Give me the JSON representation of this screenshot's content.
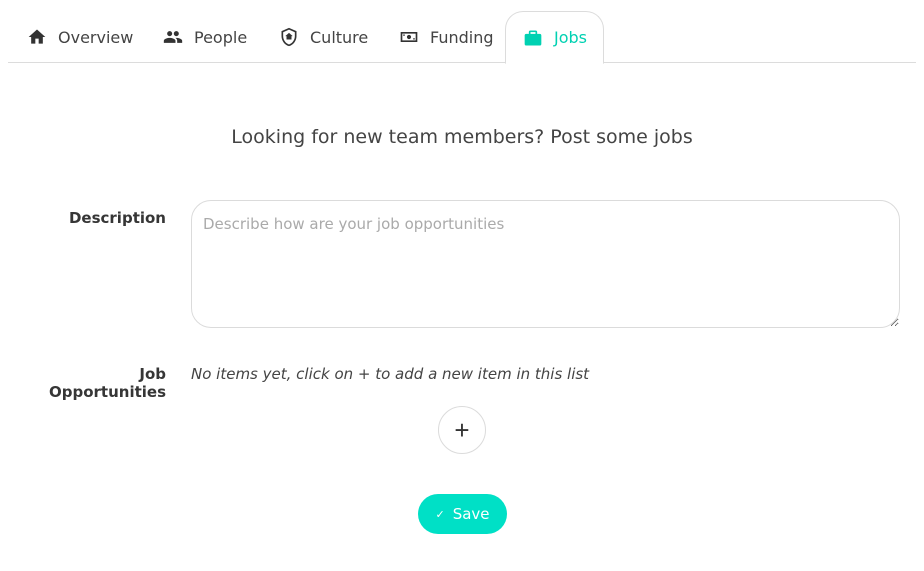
{
  "tabs": [
    {
      "label": "Overview",
      "icon": "home-icon",
      "active": false
    },
    {
      "label": "People",
      "icon": "people-icon",
      "active": false
    },
    {
      "label": "Culture",
      "icon": "shield-home-icon",
      "active": false
    },
    {
      "label": "Funding",
      "icon": "money-icon",
      "active": false
    },
    {
      "label": "Jobs",
      "icon": "briefcase-icon",
      "active": true
    }
  ],
  "headline": "Looking for new team members? Post some jobs",
  "description": {
    "label": "Description",
    "placeholder": "Describe how are your job opportunities",
    "value": ""
  },
  "job_opportunities": {
    "label": "Job Opportunities",
    "empty_message": "No items yet, click on + to add a new item in this list",
    "add_symbol": "+"
  },
  "save": {
    "label": "Save",
    "icon": "check-icon"
  },
  "colors": {
    "accent": "#00d1b2",
    "save_button": "#00e0c6",
    "border": "#dbdbdb"
  }
}
